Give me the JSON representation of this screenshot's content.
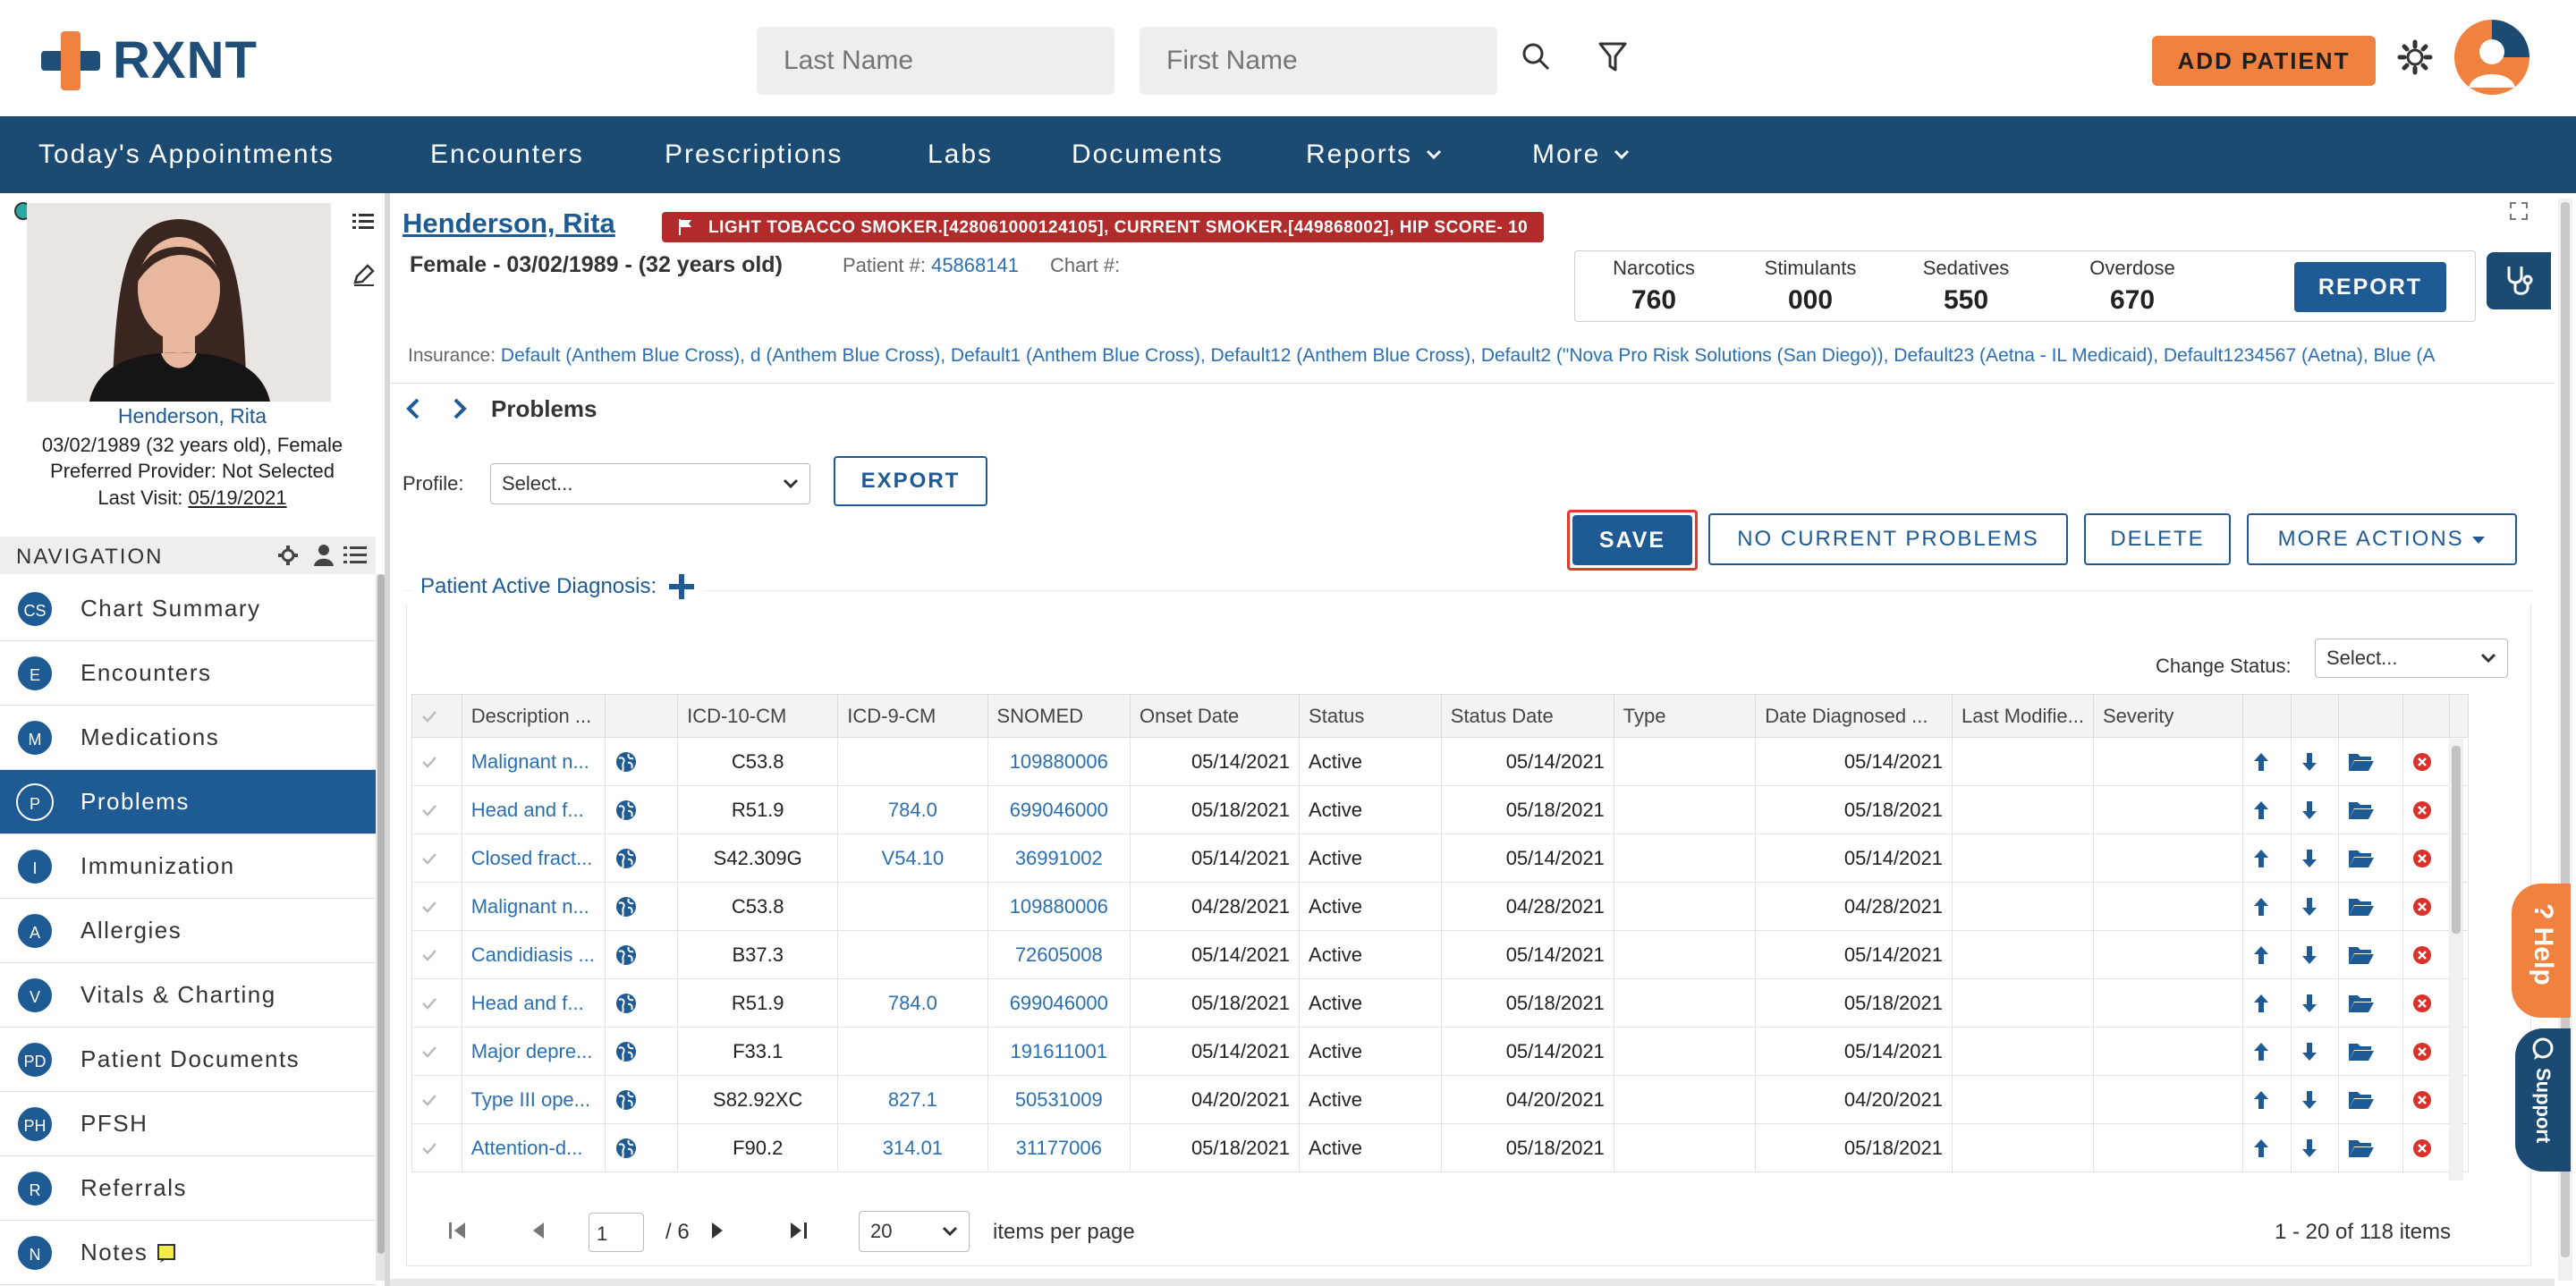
{
  "header": {
    "brand": "RXNT",
    "last_name_placeholder": "Last Name",
    "first_name_placeholder": "First Name",
    "add_patient": "ADD PATIENT"
  },
  "nav": {
    "items": [
      "Today's Appointments",
      "Encounters",
      "Prescriptions",
      "Labs",
      "Documents",
      "Reports",
      "More"
    ]
  },
  "patient_card": {
    "name": "Henderson, Rita",
    "dob_line": "03/02/1989 (32 years old), Female",
    "provider": "Preferred Provider: Not Selected",
    "last_visit_label": "Last Visit:",
    "last_visit": "05/19/2021"
  },
  "side_nav": {
    "heading": "NAVIGATION",
    "items": [
      {
        "abbr": "CS",
        "label": "Chart Summary"
      },
      {
        "abbr": "E",
        "label": "Encounters"
      },
      {
        "abbr": "M",
        "label": "Medications"
      },
      {
        "abbr": "P",
        "label": "Problems"
      },
      {
        "abbr": "I",
        "label": "Immunization"
      },
      {
        "abbr": "A",
        "label": "Allergies"
      },
      {
        "abbr": "V",
        "label": "Vitals & Charting"
      },
      {
        "abbr": "PD",
        "label": "Patient Documents"
      },
      {
        "abbr": "PH",
        "label": "PFSH"
      },
      {
        "abbr": "R",
        "label": "Referrals"
      },
      {
        "abbr": "N",
        "label": "Notes"
      }
    ],
    "active_index": 3
  },
  "patient": {
    "name": "Henderson, Rita",
    "flags": "LIGHT TOBACCO SMOKER.[428061000124105], CURRENT SMOKER.[449868002], HIP SCORE- 10",
    "demographics": "Female - 03/02/1989 - (32 years old)",
    "patient_no_label": "Patient #:",
    "patient_no": "45868141",
    "chart_no_label": "Chart #:",
    "insurance_label": "Insurance:",
    "insurance": "Default (Anthem Blue Cross), d (Anthem Blue Cross), Default1 (Anthem Blue Cross), Default12 (Anthem Blue Cross), Default2 (\"Nova Pro Risk Solutions (San Diego)), Default23 (Aetna - IL Medicaid), Default1234567 (Aetna), Blue (A"
  },
  "pdmp": {
    "items": [
      {
        "label": "Narcotics",
        "value": "760"
      },
      {
        "label": "Stimulants",
        "value": "000"
      },
      {
        "label": "Sedatives",
        "value": "550"
      },
      {
        "label": "Overdose",
        "value": "670"
      }
    ],
    "report": "REPORT"
  },
  "breadcrumb": {
    "title": "Problems"
  },
  "toolbar": {
    "profile_label": "Profile:",
    "profile_value": "Select...",
    "export": "EXPORT",
    "save": "SAVE",
    "no_current": "NO CURRENT PROBLEMS",
    "delete": "DELETE",
    "more_actions": "MORE ACTIONS"
  },
  "section": {
    "title": "Patient Active Diagnosis:",
    "change_status_label": "Change Status:",
    "change_status_value": "Select..."
  },
  "table": {
    "columns": [
      "Description ...",
      "",
      "ICD-10-CM",
      "ICD-9-CM",
      "SNOMED",
      "Onset Date",
      "Status",
      "Status Date",
      "Type",
      "Date Diagnosed ...",
      "Last Modifie...",
      "Severity"
    ],
    "rows": [
      [
        "Malignant n...",
        "C53.8",
        "",
        "109880006",
        "05/14/2021",
        "Active",
        "05/14/2021",
        "",
        "05/14/2021"
      ],
      [
        "Head and f...",
        "R51.9",
        "784.0",
        "699046000",
        "05/18/2021",
        "Active",
        "05/18/2021",
        "",
        "05/18/2021"
      ],
      [
        "Closed fract...",
        "S42.309G",
        "V54.10",
        "36991002",
        "05/14/2021",
        "Active",
        "05/14/2021",
        "",
        "05/14/2021"
      ],
      [
        "Malignant n...",
        "C53.8",
        "",
        "109880006",
        "04/28/2021",
        "Active",
        "04/28/2021",
        "",
        "04/28/2021"
      ],
      [
        "Candidiasis ...",
        "B37.3",
        "",
        "72605008",
        "05/14/2021",
        "Active",
        "05/14/2021",
        "",
        "05/14/2021"
      ],
      [
        "Head and f...",
        "R51.9",
        "784.0",
        "699046000",
        "05/18/2021",
        "Active",
        "05/18/2021",
        "",
        "05/18/2021"
      ],
      [
        "Major depre...",
        "F33.1",
        "",
        "191611001",
        "05/14/2021",
        "Active",
        "05/14/2021",
        "",
        "05/14/2021"
      ],
      [
        "Type III ope...",
        "S82.92XC",
        "827.1",
        "50531009",
        "04/20/2021",
        "Active",
        "04/20/2021",
        "",
        "04/20/2021"
      ],
      [
        "Attention-d...",
        "F90.2",
        "314.01",
        "31177006",
        "05/18/2021",
        "Active",
        "05/18/2021",
        "",
        "05/18/2021"
      ]
    ]
  },
  "pager": {
    "page": "1",
    "of": "/ 6",
    "per_page": "20",
    "per_page_label": "items per page",
    "summary": "1 - 20 of 118 items"
  },
  "side_tabs": {
    "help": "Help",
    "support": "Support"
  },
  "colors": {
    "brand": "#1b4a73",
    "accent": "#f0813f",
    "flag": "#b22b2b",
    "link": "#2a6fb3"
  }
}
